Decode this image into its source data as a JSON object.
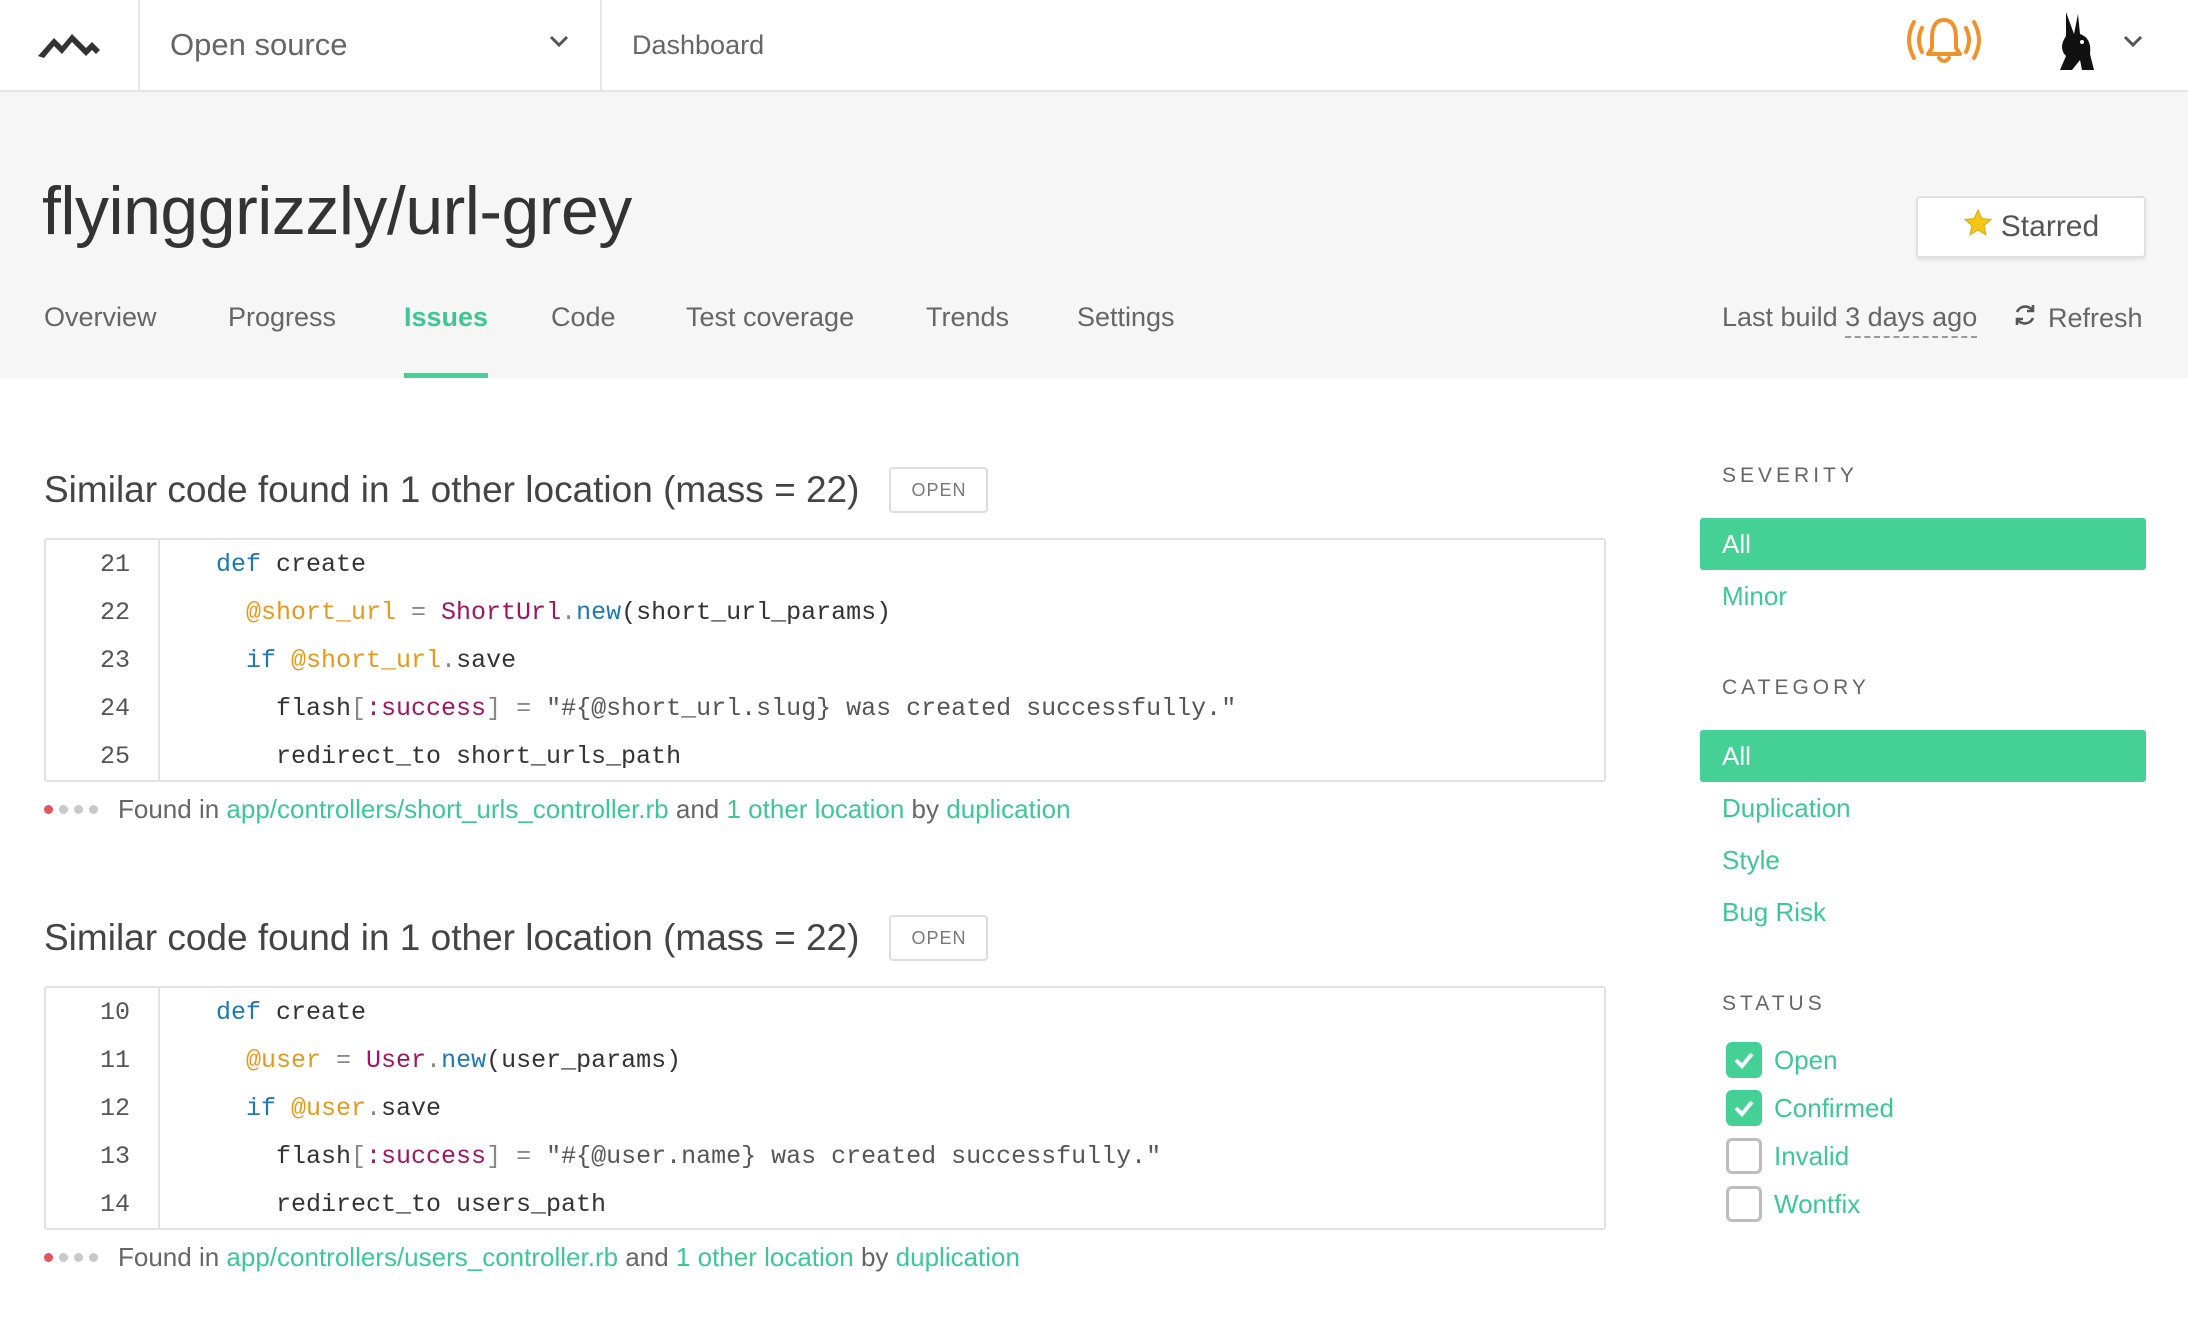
{
  "nav": {
    "org": "Open source",
    "dashboard": "Dashboard"
  },
  "repo": {
    "title": "flyinggrizzly/url-grey",
    "star_label": "Starred"
  },
  "tabs": [
    {
      "label": "Overview"
    },
    {
      "label": "Progress"
    },
    {
      "label": "Issues",
      "active": true
    },
    {
      "label": "Code"
    },
    {
      "label": "Test coverage"
    },
    {
      "label": "Trends"
    },
    {
      "label": "Settings"
    }
  ],
  "build": {
    "prefix": "Last build",
    "ago": "3 days ago",
    "refresh": "Refresh"
  },
  "issues": [
    {
      "title": "Similar code found in 1 other location (mass = 22)",
      "badge": "OPEN",
      "line_numbers": [
        "21",
        "22",
        "23",
        "24",
        "25"
      ],
      "lines": [
        {
          "kw": "def",
          "rest": " create"
        },
        {
          "iv": "@short_url",
          "op": " = ",
          "cls": "ShortUrl",
          "dot": ".",
          "mth": "new",
          "rest": "(short_url_params)"
        },
        {
          "kw": "if",
          "iv": " @short_url",
          "dot": ".",
          "rest": "save"
        },
        {
          "pre": "flash",
          "op1": "[",
          "sym": ":success",
          "op2": "] = ",
          "str": "\"#{@short_url.slug} was created successfully.\""
        },
        {
          "rest": "redirect_to short_urls_path"
        }
      ],
      "found_prefix": "Found in",
      "file": "app/controllers/short_urls_controller.rb",
      "and": "and",
      "other": "1 other location",
      "by": "by",
      "category": "duplication"
    },
    {
      "title": "Similar code found in 1 other location (mass = 22)",
      "badge": "OPEN",
      "line_numbers": [
        "10",
        "11",
        "12",
        "13",
        "14"
      ],
      "lines": [
        {
          "kw": "def",
          "rest": " create"
        },
        {
          "iv": "@user",
          "op": " = ",
          "cls": "User",
          "dot": ".",
          "mth": "new",
          "rest": "(user_params)"
        },
        {
          "kw": "if",
          "iv": " @user",
          "dot": ".",
          "rest": "save"
        },
        {
          "pre": "flash",
          "op1": "[",
          "sym": ":success",
          "op2": "] = ",
          "str": "\"#{@user.name} was created successfully.\""
        },
        {
          "rest": "redirect_to users_path"
        }
      ],
      "found_prefix": "Found in",
      "file": "app/controllers/users_controller.rb",
      "and": "and",
      "other": "1 other location",
      "by": "by",
      "category": "duplication"
    }
  ],
  "sidebar": {
    "severity": {
      "heading": "SEVERITY",
      "items": [
        "All",
        "Minor"
      ]
    },
    "category": {
      "heading": "CATEGORY",
      "items": [
        "All",
        "Duplication",
        "Style",
        "Bug Risk"
      ]
    },
    "status": {
      "heading": "STATUS",
      "items": [
        {
          "label": "Open",
          "checked": true
        },
        {
          "label": "Confirmed",
          "checked": true
        },
        {
          "label": "Invalid",
          "checked": false
        },
        {
          "label": "Wontfix",
          "checked": false
        }
      ]
    }
  },
  "colors": {
    "accent": "#45d195",
    "link": "#3ec795",
    "bell": "#f0922b"
  },
  "icons": [
    "logo-icon",
    "chevron-down-icon",
    "bell-icon",
    "avatar-icon",
    "star-icon",
    "refresh-icon",
    "check-icon"
  ]
}
